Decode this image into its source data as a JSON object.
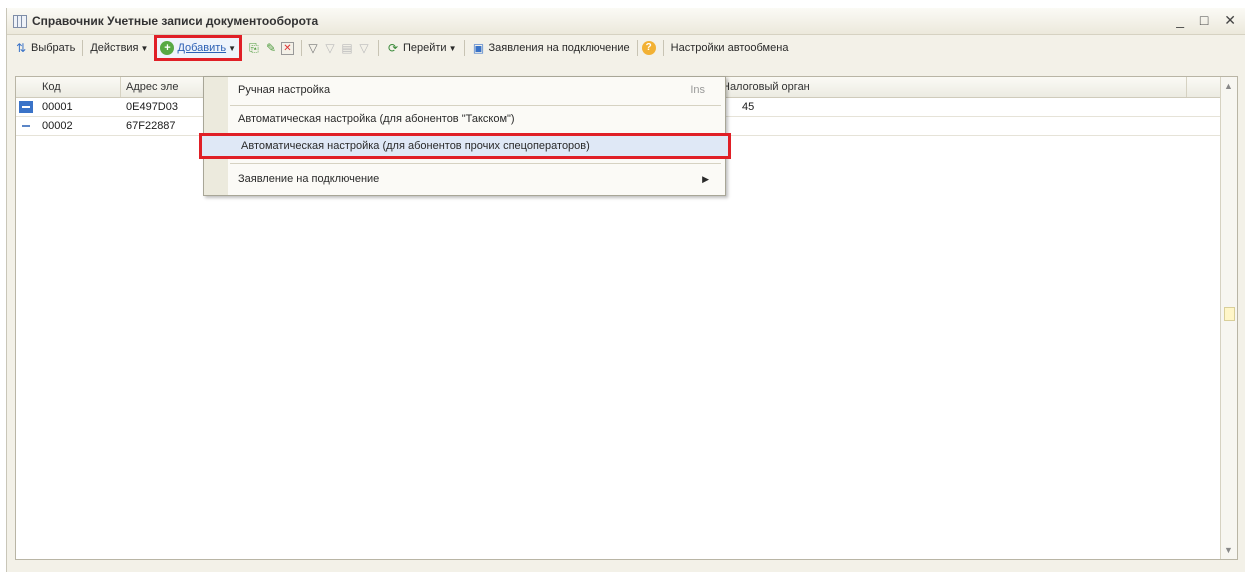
{
  "window": {
    "title": "Справочник Учетные записи документооборота",
    "controls": {
      "minimize": "_",
      "maximize": "□",
      "close": "✕"
    }
  },
  "toolbar": {
    "select_label": "Выбрать",
    "actions_label": "Действия",
    "add_label": "Добавить",
    "navigate_label": "Перейти",
    "applications_label": "Заявления на подключение",
    "autoexchange_label": "Настройки автообмена"
  },
  "table": {
    "columns": [
      "Код",
      "Адрес эле",
      "Налоговый орган"
    ],
    "rows": [
      {
        "code": "00001",
        "address": "0E497D03",
        "tax": "45",
        "selected": true
      },
      {
        "code": "00002",
        "address": "67F22887",
        "tax": "",
        "selected": false
      }
    ]
  },
  "menu": {
    "items": [
      {
        "label": "Ручная настройка",
        "shortcut": "Ins"
      },
      {
        "label": "Автоматическая настройка (для абонентов \"Такском\")"
      },
      {
        "label": "Автоматическая настройка (для абонентов прочих спецоператоров)"
      },
      {
        "label": "Заявление на подключение"
      }
    ]
  },
  "colors": {
    "highlight_border": "#e01f26",
    "selection_marker": "#3a73c8",
    "window_bg": "#f3f1e8"
  }
}
